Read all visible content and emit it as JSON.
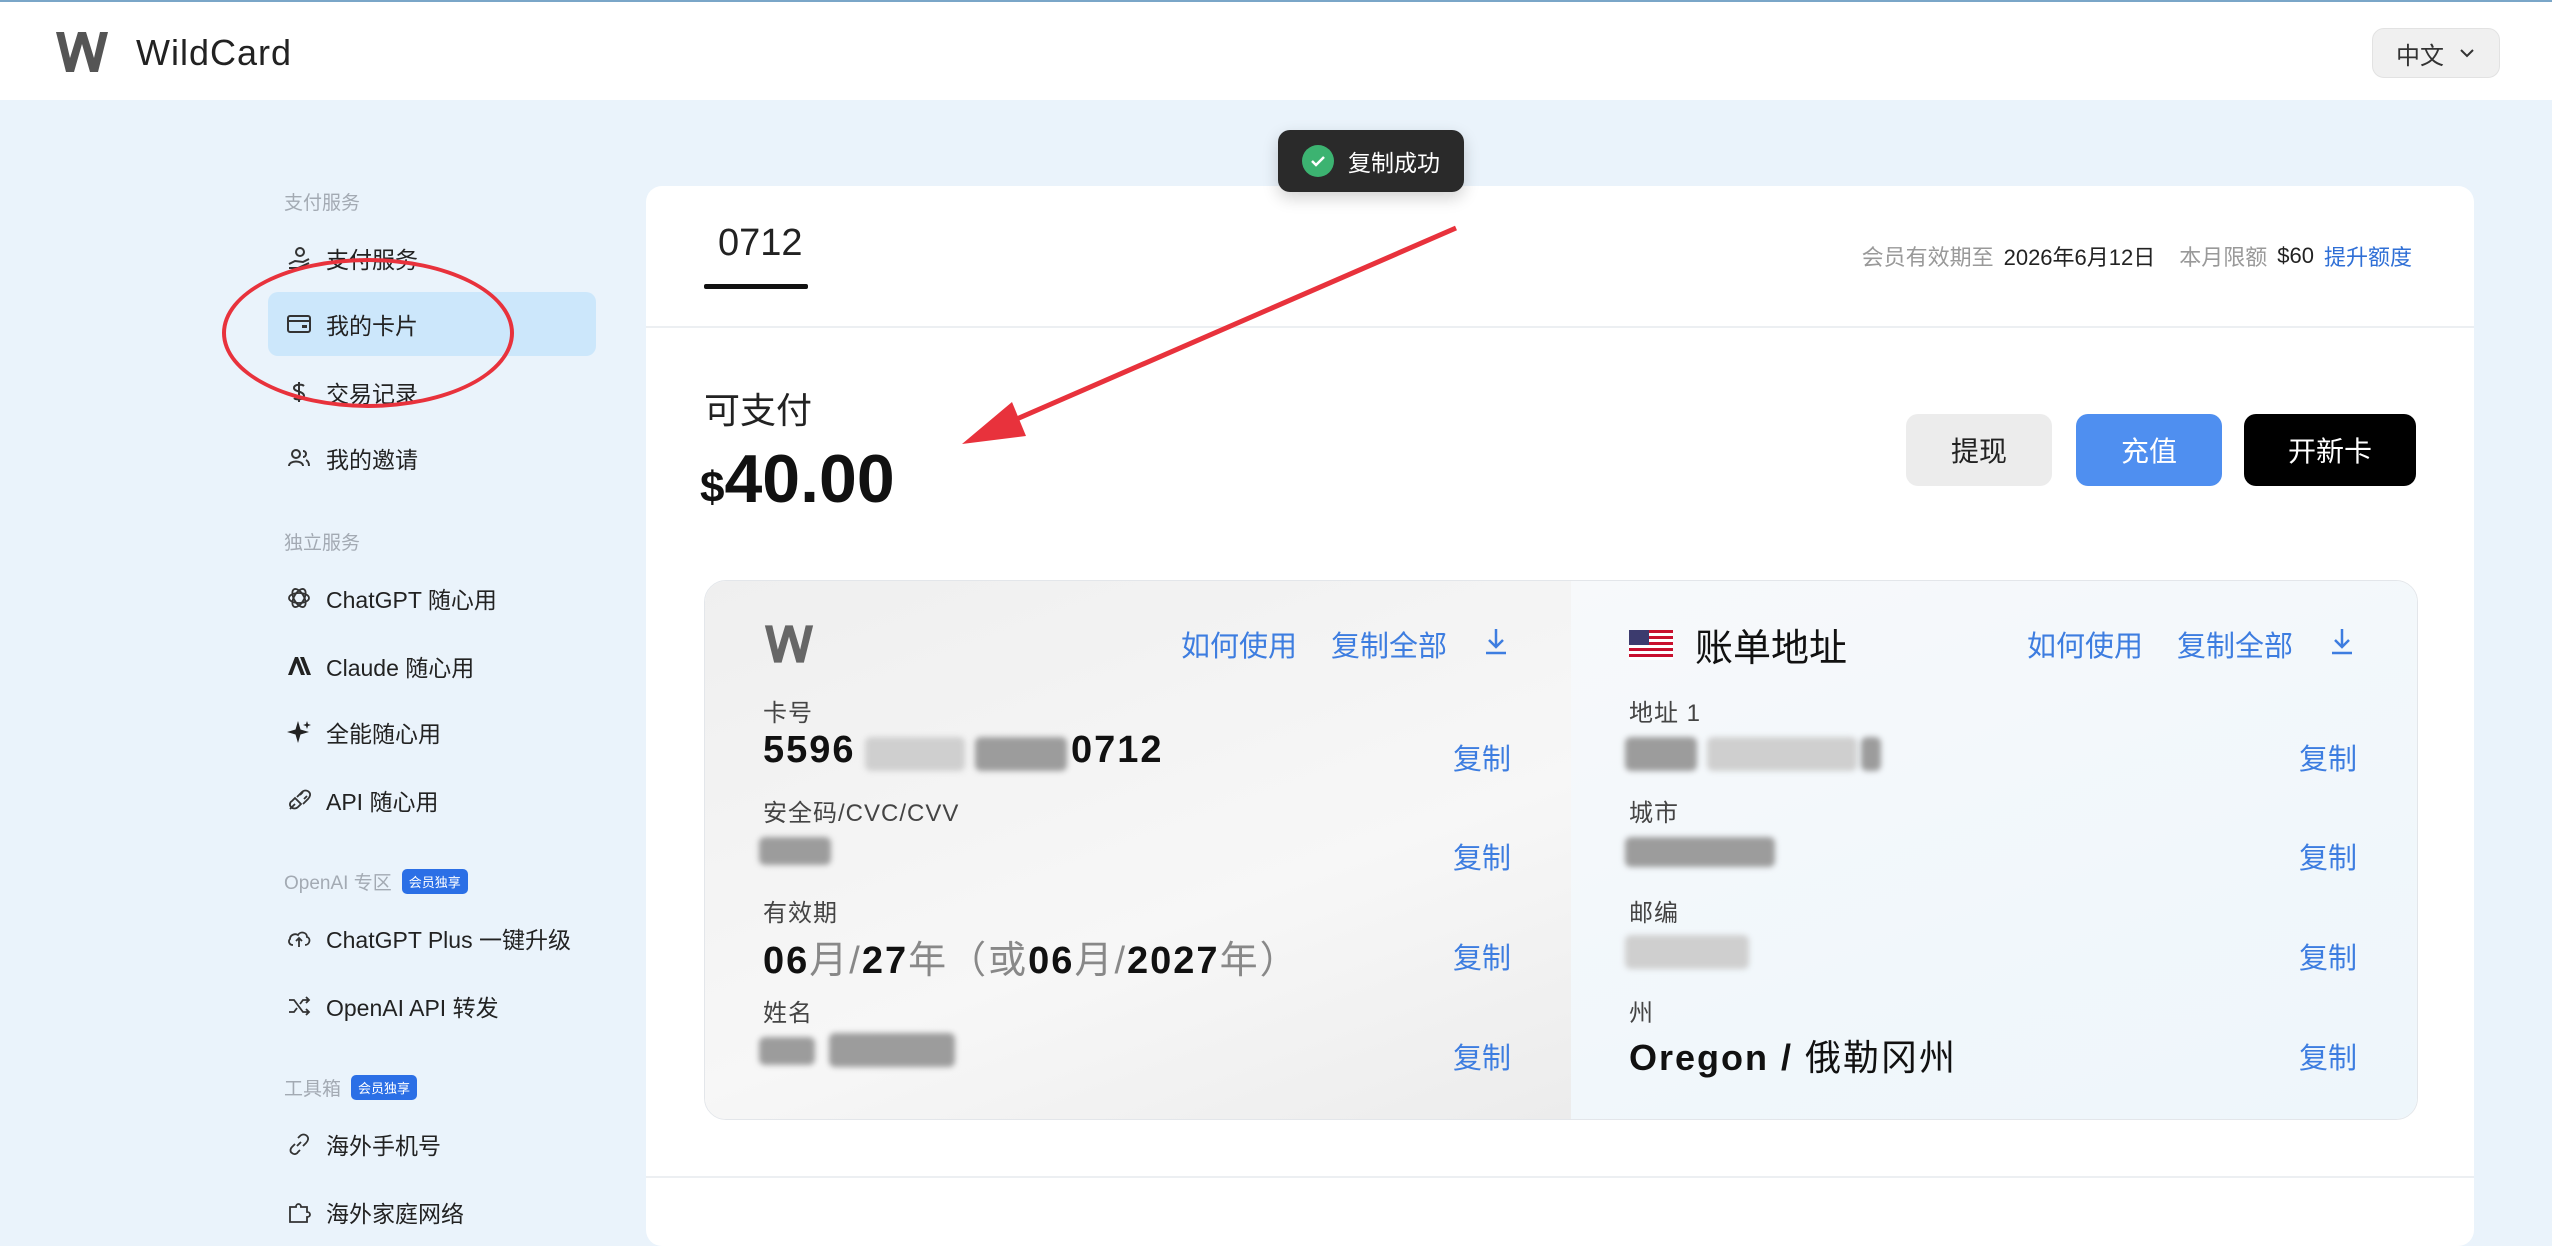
{
  "app": {
    "title": "WildCard",
    "lang": "中文"
  },
  "toast": {
    "text": "复制成功"
  },
  "sidebar": {
    "sections": [
      {
        "title": "支付服务"
      },
      {
        "title": "独立服务"
      },
      {
        "title": "OpenAI 专区",
        "badge": "会员独享"
      },
      {
        "title": "工具箱",
        "badge": "会员独享"
      }
    ],
    "items": [
      {
        "label": "支付服务",
        "icon": "hand-coin-icon"
      },
      {
        "label": "我的卡片",
        "icon": "card-icon",
        "active": true
      },
      {
        "label": "交易记录",
        "icon": "dollar-icon"
      },
      {
        "label": "我的邀请",
        "icon": "users-icon"
      },
      {
        "label": "ChatGPT 随心用",
        "icon": "openai-icon"
      },
      {
        "label": "Claude 随心用",
        "icon": "anthropic-icon"
      },
      {
        "label": "全能随心用",
        "icon": "sparkle-icon"
      },
      {
        "label": "API 随心用",
        "icon": "plug-icon"
      },
      {
        "label": "ChatGPT Plus 一键升级",
        "icon": "upgrade-icon"
      },
      {
        "label": "OpenAI API 转发",
        "icon": "shuffle-icon"
      },
      {
        "label": "海外手机号",
        "icon": "link-icon"
      },
      {
        "label": "海外家庭网络",
        "icon": "puzzle-icon"
      }
    ]
  },
  "main": {
    "card_tab": "0712",
    "member": {
      "expiry_label": "会员有效期至",
      "expiry_value": "2026年6月12日",
      "limit_label": "本月限额",
      "limit_value": "$60",
      "raise_link": "提升额度"
    },
    "balance": {
      "label": "可支付",
      "currency": "$",
      "amount": "40.00"
    },
    "buttons": {
      "withdraw": "提现",
      "topup": "充值",
      "new_card": "开新卡"
    },
    "card": {
      "how_to": "如何使用",
      "copy_all": "复制全部",
      "copy": "复制",
      "number_label": "卡号",
      "number_start": "5596",
      "number_end": "0712",
      "cvc_label": "安全码/CVC/CVV",
      "expiry_label": "有效期",
      "expiry": {
        "m": "06",
        "mo": "月",
        "sep": "/",
        "y": "27",
        "yr": "年",
        "or": "（或",
        "m2": "06",
        "mo2": "月",
        "sep2": "/",
        "y2": "2027",
        "yr2": "年）"
      },
      "name_label": "姓名"
    },
    "billing": {
      "title": "账单地址",
      "how_to": "如何使用",
      "copy_all": "复制全部",
      "copy": "复制",
      "address_label": "地址 1",
      "city_label": "城市",
      "zip_label": "邮编",
      "state_label": "州",
      "state_en": "Oregon /",
      "state_cn": " 俄勒冈州"
    }
  },
  "colors": {
    "accent": "#3d7de0",
    "active_bg": "#cce7fb",
    "annotation": "#e8323c"
  }
}
